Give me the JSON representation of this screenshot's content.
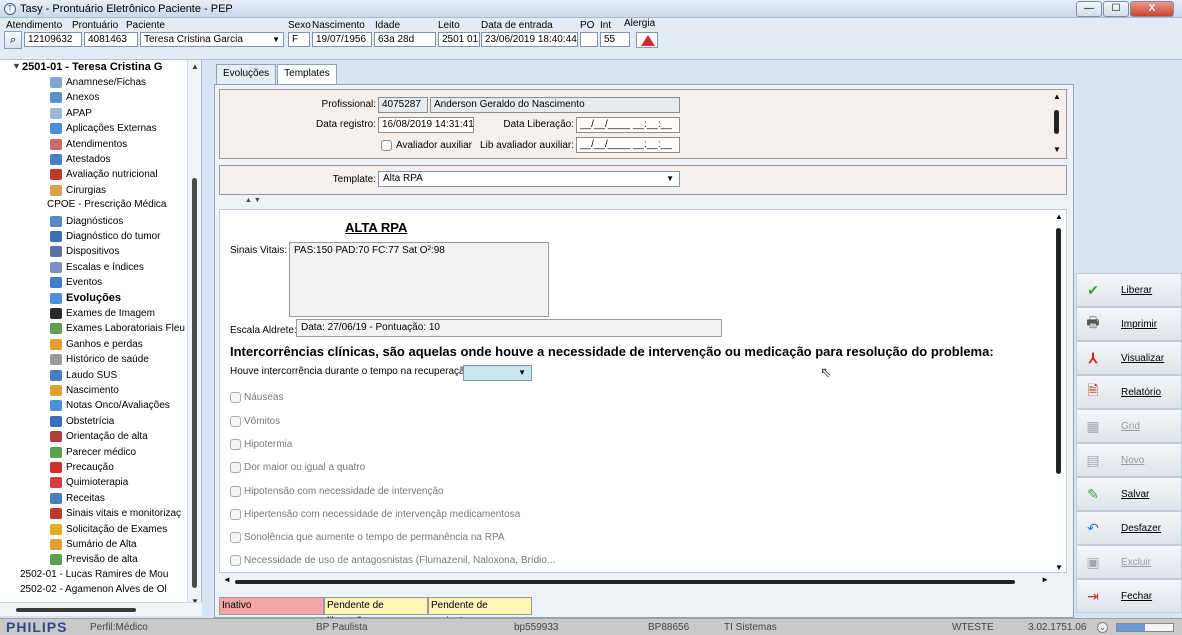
{
  "window": {
    "title": "Tasy - Prontuário Eletrônico Paciente - PEP",
    "app_icon_glyph": "T",
    "controls": [
      "—",
      "☐",
      "X"
    ]
  },
  "patient_bar": {
    "labels": {
      "atendimento": "Atendimento",
      "prontuario": "Prontuário",
      "paciente": "Paciente",
      "sexo": "Sexo",
      "nascimento": "Nascimento",
      "idade": "Idade",
      "leito": "Leito",
      "data_entrada": "Data de entrada",
      "po": "PO",
      "int": "Int",
      "alergia": "Alergia"
    },
    "values": {
      "atendimento": "12109632",
      "prontuario": "4081463",
      "paciente": "Teresa Cristina Garcia",
      "sexo": "F",
      "nascimento": "19/07/1956",
      "idade": "63a 28d",
      "leito": "2501 01",
      "data_entrada": "23/06/2019 18:40:44",
      "po": "",
      "int": "55"
    }
  },
  "tree": {
    "root": "2501-01 - Teresa Cristina G",
    "items": [
      {
        "label": "Anamnese/Fichas",
        "icon": "#7fa7d6"
      },
      {
        "label": "Anexos",
        "icon": "#5b8fc9"
      },
      {
        "label": "APAP",
        "icon": "#9bb6d8"
      },
      {
        "label": "Aplicações Externas",
        "icon": "#4a8fd8"
      },
      {
        "label": "Atendimentos",
        "icon": "#c76a6a"
      },
      {
        "label": "Atestados",
        "icon": "#4a7fc0"
      },
      {
        "label": "Avaliação nutricional",
        "icon": "#c0392b"
      },
      {
        "label": "Cirurgias",
        "icon": "#d8a04a"
      },
      {
        "label": "CPOE - Prescrição Médica",
        "icon": ""
      },
      {
        "label": "Diagnósticos",
        "icon": "#5a88c8"
      },
      {
        "label": "Diagnóstico do tumor",
        "icon": "#3a6fb8"
      },
      {
        "label": "Dispositivos",
        "icon": "#5a6fa8"
      },
      {
        "label": "Escalas e índices",
        "icon": "#7f8fc8"
      },
      {
        "label": "Eventos",
        "icon": "#3a7fc8"
      },
      {
        "label": "Evoluções",
        "icon": "#4a8fd8",
        "selected": true
      },
      {
        "label": "Exames de Imagem",
        "icon": "#2a2a2a"
      },
      {
        "label": "Exames Laboratoriais Fleu",
        "icon": "#5aa04a"
      },
      {
        "label": "Ganhos e perdas",
        "icon": "#e0a030"
      },
      {
        "label": "Histórico de saúde",
        "icon": "#9a9a9a"
      },
      {
        "label": "Laudo SUS",
        "icon": "#4a7fc0"
      },
      {
        "label": "Nascimento",
        "icon": "#e0a030"
      },
      {
        "label": "Notas Onco/Avaliações",
        "icon": "#4a8fd8"
      },
      {
        "label": "Obstetrícia",
        "icon": "#3a6fb8"
      },
      {
        "label": "Orientação de alta",
        "icon": "#b04040"
      },
      {
        "label": "Parecer médico",
        "icon": "#5aa04a"
      },
      {
        "label": "Precaução",
        "icon": "#d03030"
      },
      {
        "label": "Quimioterapia",
        "icon": "#d04040"
      },
      {
        "label": "Receitas",
        "icon": "#4a7fc0"
      },
      {
        "label": "Sinais vitais e monitorizaç",
        "icon": "#c0392b"
      },
      {
        "label": "Solicitação de Exames",
        "icon": "#e0b020"
      },
      {
        "label": "Sumário de Alta",
        "icon": "#e0a030"
      },
      {
        "label": "Previsão de alta",
        "icon": "#5aa04a"
      }
    ],
    "other_patients": [
      "2502-01 - Lucas Ramires de Mou",
      "2502-02 - Agamenon Alves de Ol"
    ]
  },
  "tabs": [
    {
      "label": "Evoluções",
      "active": false
    },
    {
      "label": "Templates",
      "active": true
    }
  ],
  "form": {
    "profissional_label": "Profissional:",
    "profissional_code": "4075287",
    "profissional_name": "Anderson Geraldo do Nascimento",
    "data_registro_label": "Data registro:",
    "data_registro": "16/08/2019 14:31:41",
    "data_liberacao_label": "Data Liberação:",
    "data_liberacao": "__/__/____ __:__:__",
    "avaliador_label": "Avaliador auxiliar",
    "lib_avaliador_label": "Lib avaliador auxiliar:",
    "lib_avaliador": "__/__/____ __:__:__",
    "template_label": "Template:",
    "template_value": "Alta RPA"
  },
  "document": {
    "title": "ALTA RPA",
    "vitals_label": "Sinais Vitais:",
    "vitals_value": "PAS:150  PAD:70  FC:77  Sat O²:98",
    "aldrete_label": "Escala Aldrete:",
    "aldrete_value": "Data: 27/06/19 - Pontuação: 10",
    "heading": "Intercorrências clínicas, são aquelas onde houve a necessidade de intervenção ou medicação para resolução do problema:",
    "question": "Houve intercorrência durante o tempo na recuperação?:",
    "options": [
      "Náuseas",
      "Vômitos",
      "Hipotermia",
      "Dor maior ou igual a quatro",
      "Hipotensão com necessidade de intervenção",
      "Hipertensão com necessidade de intervençãp medicamentosa",
      "Sonolência que aumente o tempo de permanência na RPA",
      "Necessidade de uso de antagosnistas (Flumazenil, Naloxona, Brídio..."
    ]
  },
  "status_legend": [
    {
      "label": "Inativo",
      "color": "#f4a6a6"
    },
    {
      "label": "Pendente de liberação",
      "color": "#fdf6b4"
    },
    {
      "label": "Pendente de assinatura",
      "color": "#fdf6b4"
    }
  ],
  "actions": [
    {
      "label": "Liberar",
      "icon": "checkmark-icon",
      "enabled": true
    },
    {
      "label": "Imprimir",
      "icon": "printer-icon",
      "enabled": true
    },
    {
      "label": "Visualizar",
      "icon": "pdf-icon",
      "enabled": true
    },
    {
      "label": "Relatório",
      "icon": "report-icon",
      "enabled": true
    },
    {
      "label": "Grid",
      "icon": "grid-icon",
      "enabled": false
    },
    {
      "label": "Novo",
      "icon": "new-icon",
      "enabled": false
    },
    {
      "label": "Salvar",
      "icon": "save-icon",
      "enabled": true
    },
    {
      "label": "Desfazer",
      "icon": "undo-icon",
      "enabled": true
    },
    {
      "label": "Excluir",
      "icon": "delete-icon",
      "enabled": false
    },
    {
      "label": "Fechar",
      "icon": "exit-icon",
      "enabled": true
    }
  ],
  "statusbar": {
    "brand": "PHILIPS",
    "perfil": "Perfil:Médico",
    "unidade": "BP Paulista",
    "usuario": "bp559933",
    "maquina": "BP88656",
    "setor": "TI Sistemas",
    "base": "WTESTE",
    "versao": "3.02.1751.06",
    "memory_fill_fraction": 0.5
  }
}
